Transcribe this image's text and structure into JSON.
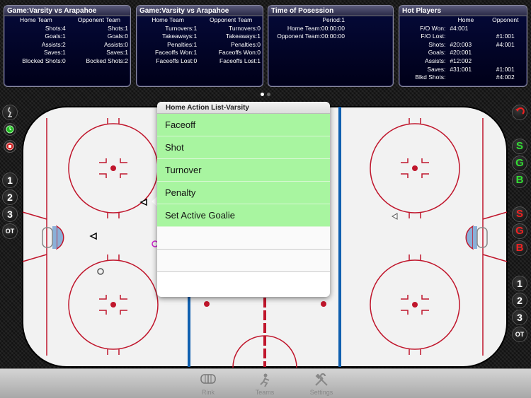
{
  "panels": {
    "game_stats": {
      "title": "Game:Varsity vs Arapahoe",
      "headers": [
        "Home Team",
        "Opponent Team"
      ],
      "rows": [
        [
          "Shots:4",
          "Shots:1"
        ],
        [
          "Goals:1",
          "Goals:0"
        ],
        [
          "Assists:2",
          "Assists:0"
        ],
        [
          "Saves:1",
          "Saves:1"
        ],
        [
          "Blocked Shots:0",
          "Bocked Shots:2"
        ]
      ]
    },
    "game_stats2": {
      "title": "Game:Varsity vs Arapahoe",
      "headers": [
        "Home Team",
        "Opponent Team"
      ],
      "rows": [
        [
          "Turnovers:1",
          "Turnovers:0"
        ],
        [
          "Takeaways:1",
          "Takeaways:1"
        ],
        [
          "Penalties:1",
          "Penalties:0"
        ],
        [
          "Faceoffs Won:1",
          "Faceoffs Won:0"
        ],
        [
          "Faceoffs Lost:0",
          "Faceoffs Lost:1"
        ]
      ]
    },
    "possession": {
      "title": "Time of Posession",
      "rows": [
        "Period:1",
        "Home Team:00:00:00",
        "Opponent Team:00:00:00"
      ]
    },
    "hot_players": {
      "title": "Hot Players",
      "headers": [
        "",
        "Home",
        "Opponent"
      ],
      "rows": [
        [
          "F/O Won:",
          "#4:001",
          ""
        ],
        [
          "F/O Lost:",
          "",
          "#1:001"
        ],
        [
          "Shots:",
          "#20:003",
          "#4:001"
        ],
        [
          "Goals:",
          "#20:001",
          ""
        ],
        [
          "Assists:",
          "#12:002",
          ""
        ],
        [
          "Saves:",
          "#31:001",
          "#1:001"
        ],
        [
          "Blkd Shots:",
          "",
          "#4:002"
        ]
      ]
    }
  },
  "left_sidebar": {
    "periods": [
      "1",
      "2",
      "3",
      "OT"
    ]
  },
  "right_sidebar": {
    "home_buttons": [
      "S",
      "G",
      "B"
    ],
    "away_buttons": [
      "S",
      "G",
      "B"
    ],
    "periods": [
      "1",
      "2",
      "3",
      "OT"
    ]
  },
  "action_menu": {
    "title": "Home Action List-Varsity",
    "items": [
      "Faceoff",
      "Shot",
      "Turnover",
      "Penalty",
      "Set Active Goalie"
    ]
  },
  "tabs": [
    {
      "label": "Rink",
      "icon": "rink-icon"
    },
    {
      "label": "Teams",
      "icon": "skater-icon"
    },
    {
      "label": "Settings",
      "icon": "tools-icon"
    }
  ],
  "colors": {
    "rink_red": "#c0162c",
    "rink_blue": "#1060b0",
    "menu_green": "#a8f5a0",
    "panel_bg": "#050a3a"
  }
}
